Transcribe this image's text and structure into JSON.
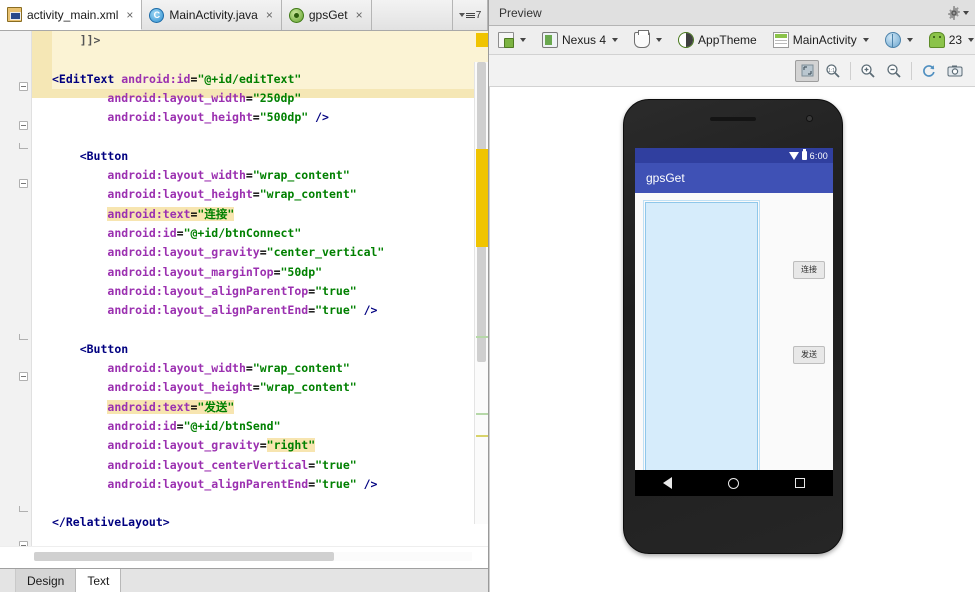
{
  "editor": {
    "tabs": [
      {
        "label": "activity_main.xml",
        "icon": "xml-layout-icon",
        "active": true,
        "close": "×"
      },
      {
        "label": "MainActivity.java",
        "icon": "java-class-icon",
        "active": false,
        "close": "×"
      },
      {
        "label": "gpsGet",
        "icon": "android-module-icon",
        "active": false,
        "close": "×"
      }
    ],
    "overflow_count": "7",
    "bottom_tabs": [
      {
        "label": "Design",
        "active": false
      },
      {
        "label": "Text",
        "active": true
      }
    ],
    "code_lines": [
      {
        "indent": 1,
        "highlight": "block",
        "tokens": [
          {
            "t": "]]>",
            "c": "s-plain"
          }
        ]
      },
      {
        "indent": 0,
        "highlight": "block",
        "tokens": []
      },
      {
        "indent": 0,
        "highlight": "block",
        "tokens": [
          {
            "t": "<EditText ",
            "c": "s-tag"
          },
          {
            "t": "android:id",
            "c": "s-attr"
          },
          {
            "t": "=",
            "c": "s-punct"
          },
          {
            "t": "\"@+id/editText\"",
            "c": "s-val"
          }
        ]
      },
      {
        "indent": 2,
        "tokens": [
          {
            "t": "android:layout_width",
            "c": "s-attr"
          },
          {
            "t": "=",
            "c": "s-punct"
          },
          {
            "t": "\"250dp\"",
            "c": "s-val"
          }
        ]
      },
      {
        "indent": 2,
        "tokens": [
          {
            "t": "android:layout_height",
            "c": "s-attr"
          },
          {
            "t": "=",
            "c": "s-punct"
          },
          {
            "t": "\"500dp\"",
            "c": "s-val"
          },
          {
            "t": " />",
            "c": "s-tag"
          }
        ]
      },
      {
        "indent": 0,
        "tokens": []
      },
      {
        "indent": 1,
        "tokens": [
          {
            "t": "<Button",
            "c": "s-tag"
          }
        ]
      },
      {
        "indent": 2,
        "tokens": [
          {
            "t": "android:layout_width",
            "c": "s-attr"
          },
          {
            "t": "=",
            "c": "s-punct"
          },
          {
            "t": "\"wrap_content\"",
            "c": "s-val"
          }
        ]
      },
      {
        "indent": 2,
        "tokens": [
          {
            "t": "android:layout_height",
            "c": "s-attr"
          },
          {
            "t": "=",
            "c": "s-punct"
          },
          {
            "t": "\"wrap_content\"",
            "c": "s-val"
          }
        ]
      },
      {
        "indent": 2,
        "highlight": "word",
        "tokens": [
          {
            "t": "android:text",
            "c": "s-attr"
          },
          {
            "t": "=",
            "c": "s-punct"
          },
          {
            "t": "\"连接\"",
            "c": "s-val"
          }
        ]
      },
      {
        "indent": 2,
        "tokens": [
          {
            "t": "android:id",
            "c": "s-attr"
          },
          {
            "t": "=",
            "c": "s-punct"
          },
          {
            "t": "\"@+id/btnConnect\"",
            "c": "s-val"
          }
        ]
      },
      {
        "indent": 2,
        "tokens": [
          {
            "t": "android:layout_gravity",
            "c": "s-attr"
          },
          {
            "t": "=",
            "c": "s-punct"
          },
          {
            "t": "\"center_vertical\"",
            "c": "s-val"
          }
        ]
      },
      {
        "indent": 2,
        "tokens": [
          {
            "t": "android:layout_marginTop",
            "c": "s-attr"
          },
          {
            "t": "=",
            "c": "s-punct"
          },
          {
            "t": "\"50dp\"",
            "c": "s-val"
          }
        ]
      },
      {
        "indent": 2,
        "tokens": [
          {
            "t": "android:layout_alignParentTop",
            "c": "s-attr"
          },
          {
            "t": "=",
            "c": "s-punct"
          },
          {
            "t": "\"true\"",
            "c": "s-val"
          }
        ]
      },
      {
        "indent": 2,
        "tokens": [
          {
            "t": "android:layout_alignParentEnd",
            "c": "s-attr"
          },
          {
            "t": "=",
            "c": "s-punct"
          },
          {
            "t": "\"true\"",
            "c": "s-val"
          },
          {
            "t": " />",
            "c": "s-tag"
          }
        ]
      },
      {
        "indent": 0,
        "tokens": []
      },
      {
        "indent": 1,
        "tokens": [
          {
            "t": "<Button",
            "c": "s-tag"
          }
        ]
      },
      {
        "indent": 2,
        "tokens": [
          {
            "t": "android:layout_width",
            "c": "s-attr"
          },
          {
            "t": "=",
            "c": "s-punct"
          },
          {
            "t": "\"wrap_content\"",
            "c": "s-val"
          }
        ]
      },
      {
        "indent": 2,
        "tokens": [
          {
            "t": "android:layout_height",
            "c": "s-attr"
          },
          {
            "t": "=",
            "c": "s-punct"
          },
          {
            "t": "\"wrap_content\"",
            "c": "s-val"
          }
        ]
      },
      {
        "indent": 2,
        "highlight": "word",
        "tokens": [
          {
            "t": "android:text",
            "c": "s-attr"
          },
          {
            "t": "=",
            "c": "s-punct"
          },
          {
            "t": "\"发送\"",
            "c": "s-val"
          }
        ]
      },
      {
        "indent": 2,
        "tokens": [
          {
            "t": "android:id",
            "c": "s-attr"
          },
          {
            "t": "=",
            "c": "s-punct"
          },
          {
            "t": "\"@+id/btnSend\"",
            "c": "s-val"
          }
        ]
      },
      {
        "indent": 2,
        "highlight": "word-right",
        "tokens": [
          {
            "t": "android:layout_gravity",
            "c": "s-attr"
          },
          {
            "t": "=",
            "c": "s-punct"
          },
          {
            "t": "\"right\"",
            "c": "s-val"
          }
        ]
      },
      {
        "indent": 2,
        "tokens": [
          {
            "t": "android:layout_centerVertical",
            "c": "s-attr"
          },
          {
            "t": "=",
            "c": "s-punct"
          },
          {
            "t": "\"true\"",
            "c": "s-val"
          }
        ]
      },
      {
        "indent": 2,
        "tokens": [
          {
            "t": "android:layout_alignParentEnd",
            "c": "s-attr"
          },
          {
            "t": "=",
            "c": "s-punct"
          },
          {
            "t": "\"true\"",
            "c": "s-val"
          },
          {
            "t": " />",
            "c": "s-tag"
          }
        ]
      },
      {
        "indent": 0,
        "tokens": []
      },
      {
        "indent": 0,
        "tokens": [
          {
            "t": "</RelativeLayout>",
            "c": "s-tag"
          }
        ]
      }
    ]
  },
  "preview": {
    "title": "Preview",
    "settings_icon": "gear-icon",
    "toolbar": [
      {
        "name": "layout-variant",
        "label": "",
        "icon": "layout-icon",
        "caret": true
      },
      {
        "name": "device",
        "label": "Nexus 4",
        "icon": "device-icon",
        "caret": true
      },
      {
        "name": "orientation",
        "label": "",
        "icon": "orientation-icon",
        "caret": true
      },
      {
        "name": "theme",
        "label": "AppTheme",
        "icon": "theme-icon",
        "caret": false
      },
      {
        "name": "activity",
        "label": "MainActivity",
        "icon": "activity-icon",
        "caret": true
      },
      {
        "name": "locale",
        "label": "",
        "icon": "locale-icon",
        "caret": true
      },
      {
        "name": "api-level",
        "label": "23",
        "icon": "android-api-icon",
        "caret": true
      }
    ],
    "zoom_buttons": [
      {
        "name": "zoom-fit",
        "icon": "fit-to-screen-icon",
        "pressed": true
      },
      {
        "name": "zoom-actual",
        "icon": "zoom-actual-size-icon",
        "pressed": false
      },
      {
        "name": "zoom-in",
        "icon": "zoom-in-icon",
        "pressed": false
      },
      {
        "name": "zoom-out",
        "icon": "zoom-out-icon",
        "pressed": false
      },
      {
        "name": "refresh",
        "icon": "refresh-icon",
        "pressed": false
      },
      {
        "name": "screenshot",
        "icon": "camera-icon",
        "pressed": false
      }
    ],
    "device_screen": {
      "status_time": "6:00",
      "app_title": "gpsGet",
      "buttons": [
        {
          "name": "btnConnect",
          "label": "连接"
        },
        {
          "name": "btnSend",
          "label": "发送"
        }
      ],
      "nav": [
        "back",
        "home",
        "recents"
      ]
    }
  },
  "colors": {
    "action_bar": "#3f51b5",
    "status_bar": "#303f9f",
    "edit_text_fill": "#d6ecfb",
    "highlight": "#f5e7b5",
    "warning_marker": "#f0c400"
  }
}
